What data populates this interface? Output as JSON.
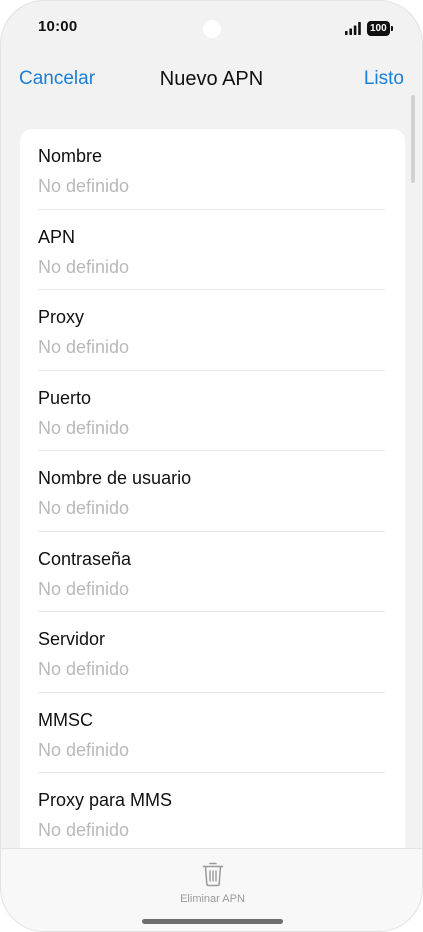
{
  "status_bar": {
    "time": "10:00",
    "battery": "100",
    "signal_icon": "signal-bars-icon"
  },
  "nav": {
    "cancel_label": "Cancelar",
    "title": "Nuevo APN",
    "done_label": "Listo"
  },
  "fields": [
    {
      "label": "Nombre",
      "value": "No definido"
    },
    {
      "label": "APN",
      "value": "No definido"
    },
    {
      "label": "Proxy",
      "value": "No definido"
    },
    {
      "label": "Puerto",
      "value": "No definido"
    },
    {
      "label": "Nombre de usuario",
      "value": "No definido"
    },
    {
      "label": "Contraseña",
      "value": "No definido"
    },
    {
      "label": "Servidor",
      "value": "No definido"
    },
    {
      "label": "MMSC",
      "value": "No definido"
    },
    {
      "label": "Proxy para MMS",
      "value": "No definido"
    }
  ],
  "toolbar": {
    "delete_label": "Eliminar APN",
    "delete_icon": "trash-icon"
  },
  "colors": {
    "accent": "#1a7fd6",
    "placeholder": "#b9b9b9",
    "background": "#f2f2f2"
  }
}
